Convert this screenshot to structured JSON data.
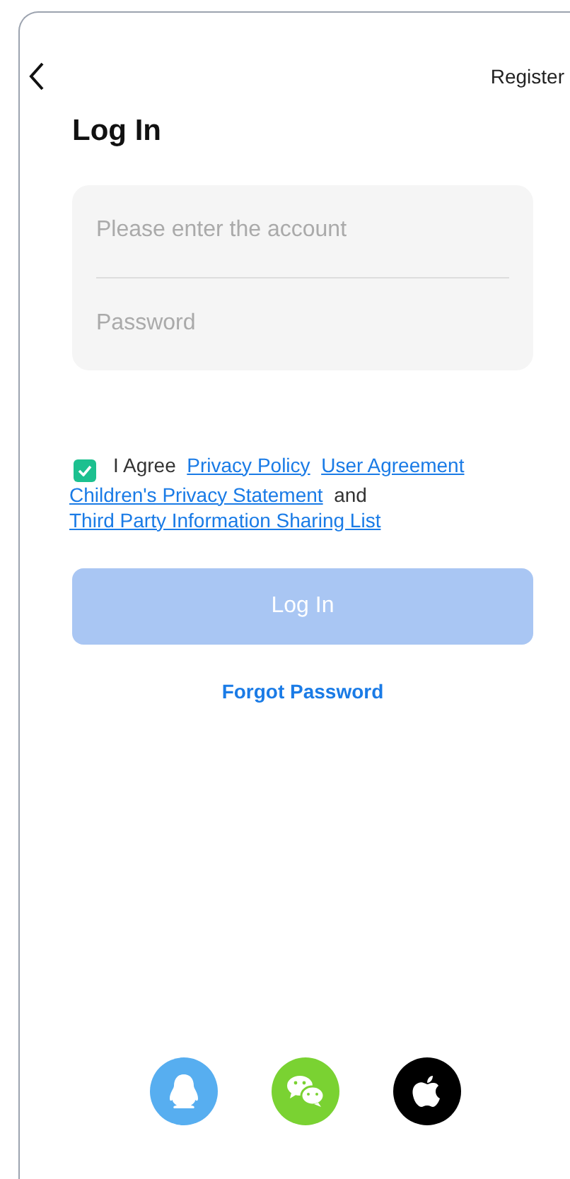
{
  "nav": {
    "register": "Register"
  },
  "title": "Log In",
  "fields": [
    {
      "placeholder": "Please enter the account"
    },
    {
      "placeholder": "Password"
    }
  ],
  "agreement": {
    "checked": true,
    "parts": [
      {
        "kind": "text",
        "text": "I Agree"
      },
      {
        "kind": "link",
        "text": "Privacy Policy"
      },
      {
        "kind": "link",
        "text": "User Agreement"
      },
      {
        "kind": "link",
        "text": "Children's Privacy Statement"
      },
      {
        "kind": "text",
        "text": "and"
      },
      {
        "kind": "link",
        "text": "Third Party Information Sharing List"
      }
    ]
  },
  "login_button": {
    "label": "Log In",
    "disabled": true
  },
  "forgot": "Forgot Password",
  "social": [
    {
      "kind": "penguin"
    },
    {
      "kind": "chat"
    },
    {
      "kind": "apple"
    }
  ]
}
